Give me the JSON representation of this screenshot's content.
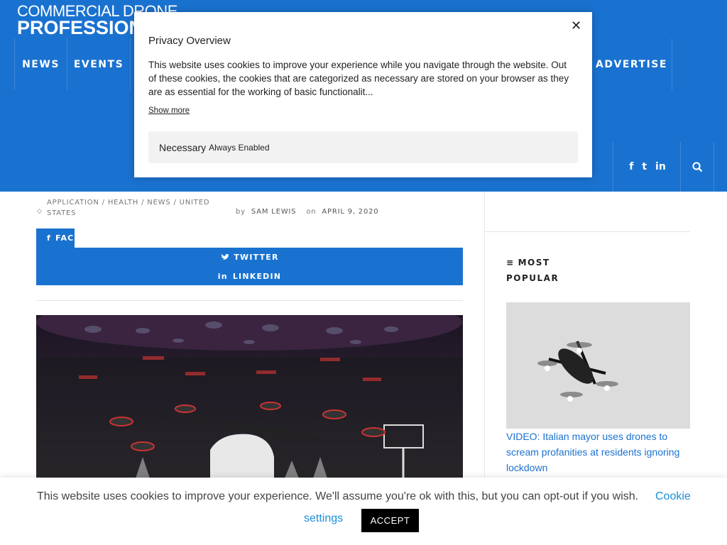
{
  "brand": {
    "line1": "COMMERCIAL DRONE",
    "line2": "PROFESSIONAL"
  },
  "nav": {
    "news": "NEWS",
    "events": "EVENTS",
    "advertise": "ADVERTISE"
  },
  "social": {
    "facebook": "f",
    "twitter": "t",
    "linkedin": "in"
  },
  "article": {
    "categories": [
      "APPLICATION",
      "HEALTH",
      "NEWS",
      "UNITED STATES"
    ],
    "by": "by",
    "author": "SAM LEWIS",
    "on": "on",
    "date": "APRIL 9, 2020"
  },
  "share": {
    "facebook": "FACEBOOK",
    "twitter": "TWITTER",
    "linkedin": "LINKEDIN"
  },
  "sidebar": {
    "heading_line1": "MOST",
    "heading_line2": "POPULAR",
    "post_title": "VIDEO: Italian mayor uses drones to scream profanities at residents ignoring lockdown"
  },
  "privacy_modal": {
    "title": "Privacy Overview",
    "close": "✕",
    "body": "This website uses cookies to improve your experience while you navigate through the website. Out of these cookies, the cookies that are categorized as necessary are stored on your browser as they are as essential for the working of basic functionalit...",
    "show_more": "Show more",
    "necessary_label": "Necessary",
    "necessary_status": "Always Enabled"
  },
  "cookie_bar": {
    "text": "This website uses cookies to improve your experience. We'll assume you're ok with this, but you can opt-out if you wish.",
    "settings_line1": "Cookie",
    "settings_line2": "settings",
    "accept": "ACCEPT"
  },
  "colors": {
    "primary": "#1a72d0",
    "link": "#1a8fdc",
    "modal_bg": "#ffffff",
    "accept_bg": "#000000"
  },
  "icons": [
    "search-icon",
    "close-icon",
    "tag-icon",
    "menu-icon",
    "facebook-icon",
    "twitter-icon",
    "linkedin-icon"
  ]
}
